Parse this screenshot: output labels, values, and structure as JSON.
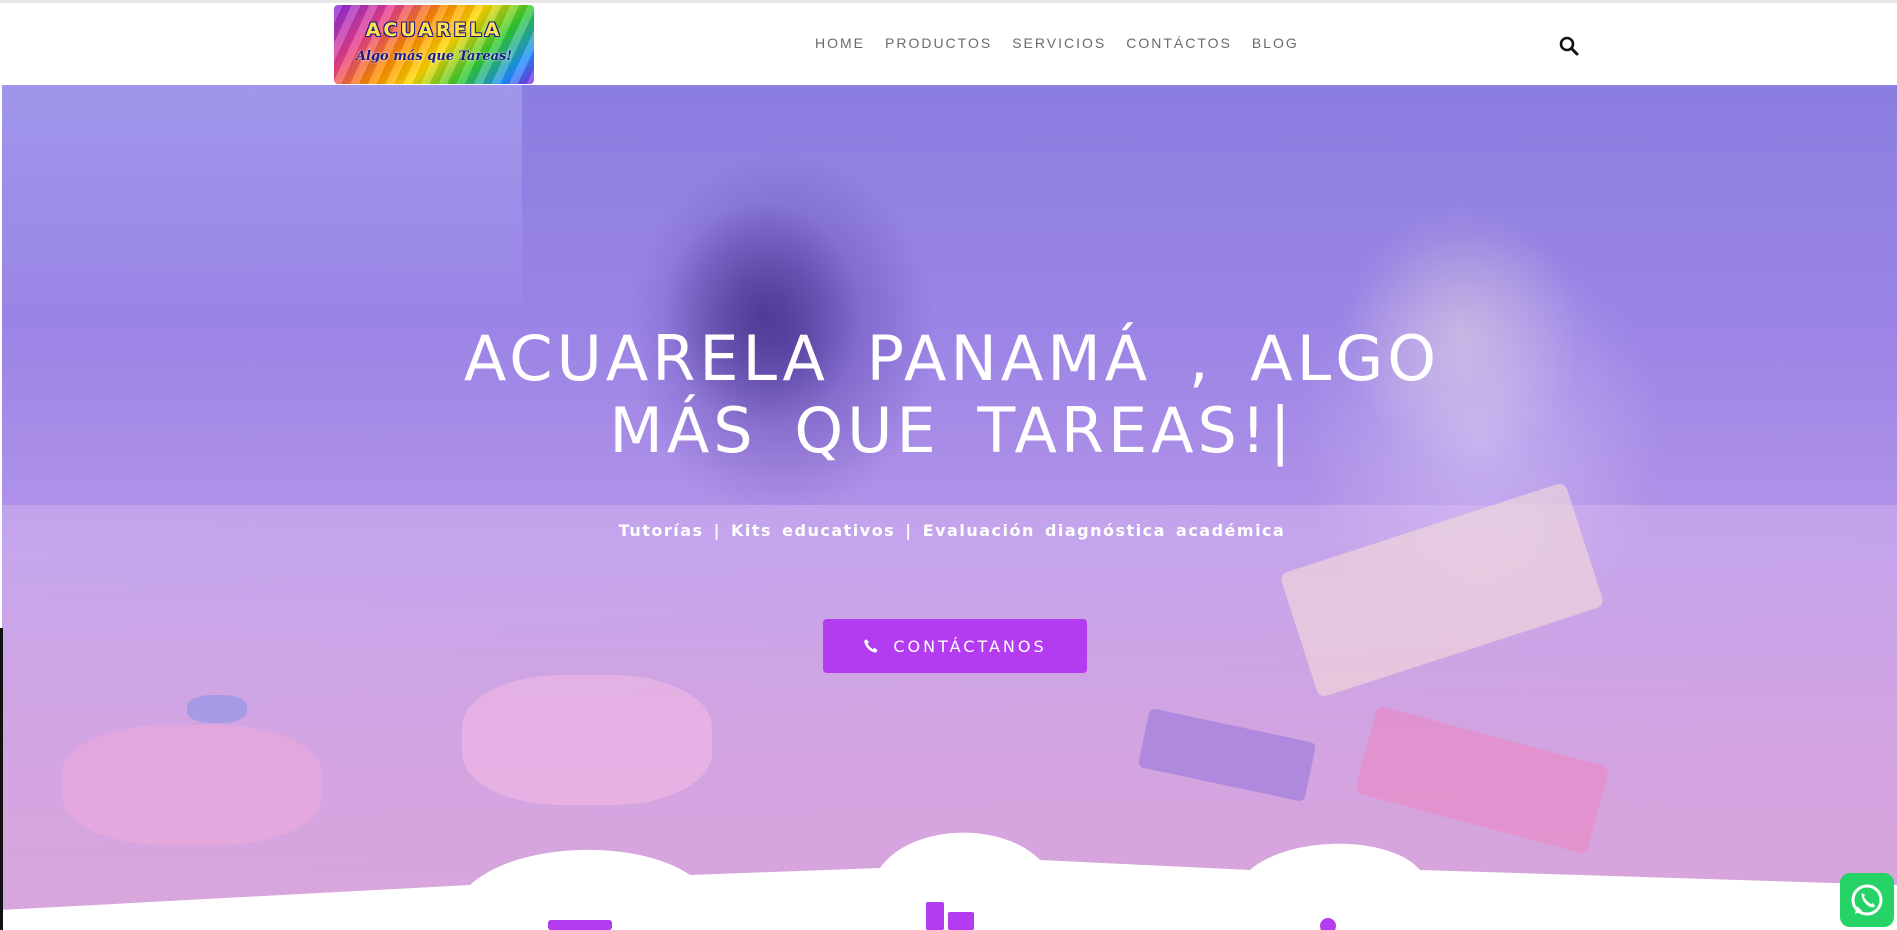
{
  "logo": {
    "title": "ACUARELA",
    "tagline": "Algo más que Tareas!"
  },
  "nav": {
    "items": [
      {
        "label": "HOME"
      },
      {
        "label": "PRODUCTOS"
      },
      {
        "label": "SERVICIOS"
      },
      {
        "label": "CONTÁCTOS"
      },
      {
        "label": "BLOG"
      }
    ],
    "search_icon": "search-icon"
  },
  "hero": {
    "title_line1": "ACUARELA PANAMÁ , ALGO",
    "title_line2": "MÁS QUE TAREAS!|",
    "subtitle": "Tutorías | Kits educativos | Evaluación diagnóstica académica",
    "cta_label": "CONTÁCTANOS",
    "cta_icon": "phone-icon"
  },
  "floating": {
    "whatsapp_icon": "whatsapp-icon"
  },
  "colors": {
    "accent": "#b33cf0",
    "nav_text": "#6b6b6b",
    "whatsapp": "#25d366"
  }
}
